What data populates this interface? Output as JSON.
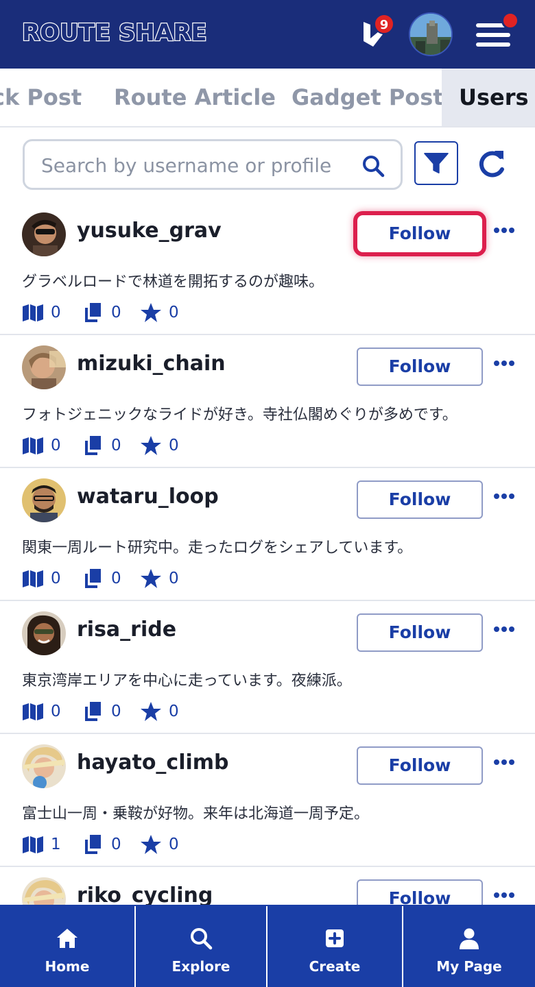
{
  "header": {
    "app_title": "ROUTE SHARE",
    "notification_count": "9"
  },
  "tabs": [
    {
      "label": "ck Post",
      "active": false
    },
    {
      "label": "Route Article",
      "active": false
    },
    {
      "label": "Gadget Post",
      "active": false
    },
    {
      "label": "Users",
      "active": true
    }
  ],
  "search": {
    "placeholder": "Search by username or profile",
    "value": ""
  },
  "users": [
    {
      "username": "yusuke_grav",
      "bio": "グラベルロードで林道を開拓するのが趣味。",
      "routes": "0",
      "posts": "0",
      "favorites": "0",
      "follow_label": "Follow",
      "highlighted": true
    },
    {
      "username": "mizuki_chain",
      "bio": "フォトジェニックなライドが好き。寺社仏閣めぐりが多めです。",
      "routes": "0",
      "posts": "0",
      "favorites": "0",
      "follow_label": "Follow",
      "highlighted": false
    },
    {
      "username": "wataru_loop",
      "bio": "関東一周ルート研究中。走ったログをシェアしています。",
      "routes": "0",
      "posts": "0",
      "favorites": "0",
      "follow_label": "Follow",
      "highlighted": false
    },
    {
      "username": "risa_ride",
      "bio": "東京湾岸エリアを中心に走っています。夜練派。",
      "routes": "0",
      "posts": "0",
      "favorites": "0",
      "follow_label": "Follow",
      "highlighted": false
    },
    {
      "username": "hayato_climb",
      "bio": "富士山一周・乗鞍が好物。来年は北海道一周予定。",
      "routes": "1",
      "posts": "0",
      "favorites": "0",
      "follow_label": "Follow",
      "highlighted": false
    },
    {
      "username": "riko_cycling",
      "bio": "",
      "routes": "",
      "posts": "",
      "favorites": "",
      "follow_label": "Follow",
      "highlighted": false
    }
  ],
  "bottom_nav": [
    {
      "label": "Home",
      "icon": "home-icon"
    },
    {
      "label": "Explore",
      "icon": "search-icon"
    },
    {
      "label": "Create",
      "icon": "plus-square-icon"
    },
    {
      "label": "My Page",
      "icon": "user-icon"
    }
  ],
  "colors": {
    "header_bg": "#1a2d7a",
    "accent": "#1a3ea6",
    "badge_red": "#e02323",
    "highlight_border": "#dc1f4d",
    "active_tab_bg": "#e5e8f0"
  }
}
